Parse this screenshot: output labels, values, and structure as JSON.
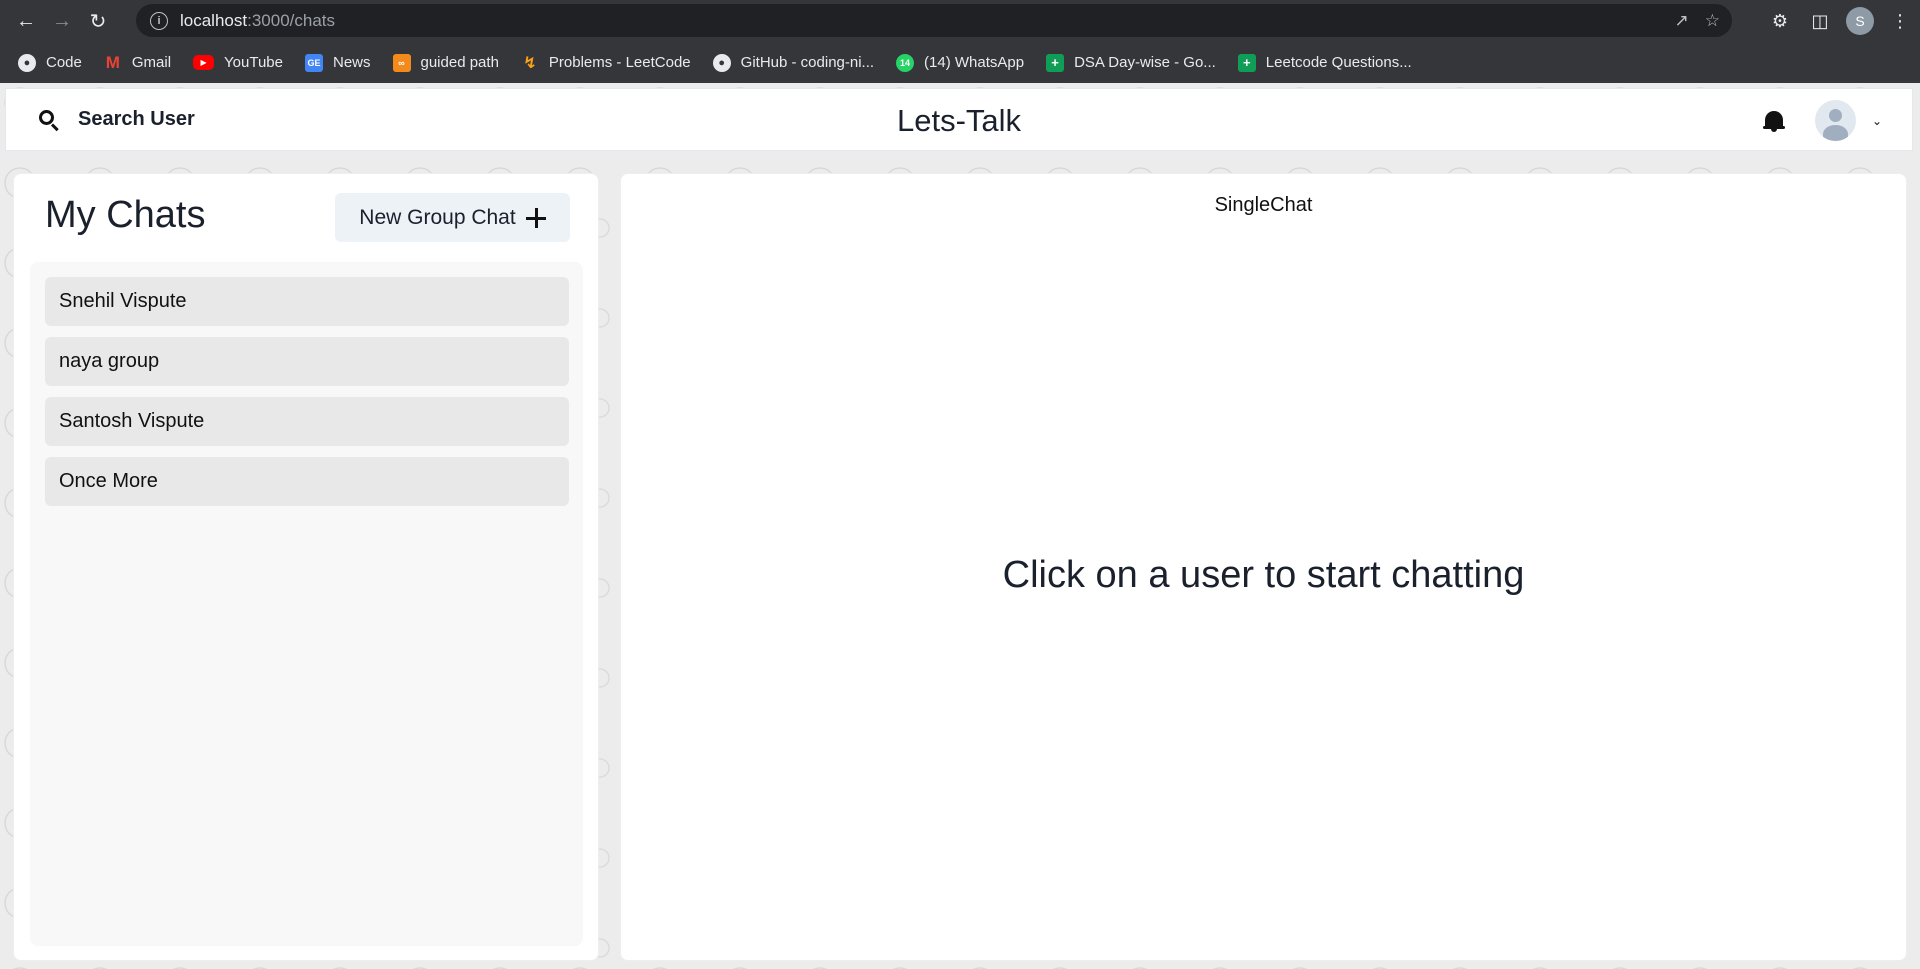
{
  "browser": {
    "url_host": "localhost",
    "url_path": ":3000/chats",
    "profile_initial": "S",
    "bookmarks": [
      {
        "label": "Code",
        "icon": "github-icon"
      },
      {
        "label": "Gmail",
        "icon": "gmail-icon"
      },
      {
        "label": "YouTube",
        "icon": "youtube-icon"
      },
      {
        "label": "News",
        "icon": "google-news-icon"
      },
      {
        "label": "guided path",
        "icon": "coding-ninjas-icon"
      },
      {
        "label": "Problems - LeetCode",
        "icon": "leetcode-icon"
      },
      {
        "label": "GitHub - coding-ni...",
        "icon": "github-icon"
      },
      {
        "label": "(14) WhatsApp",
        "icon": "whatsapp-icon"
      },
      {
        "label": "DSA Day-wise - Go...",
        "icon": "google-sheets-icon"
      },
      {
        "label": "Leetcode Questions...",
        "icon": "google-sheets-icon"
      }
    ]
  },
  "header": {
    "search_label": "Search User",
    "app_title": "Lets-Talk"
  },
  "my_chats": {
    "title": "My Chats",
    "new_group_label": "New Group Chat",
    "chats": [
      {
        "name": "Snehil Vispute"
      },
      {
        "name": "naya group"
      },
      {
        "name": "Santosh Vispute"
      },
      {
        "name": "Once More"
      }
    ]
  },
  "single_chat": {
    "label": "SingleChat",
    "empty_message": "Click on a user to start chatting"
  }
}
